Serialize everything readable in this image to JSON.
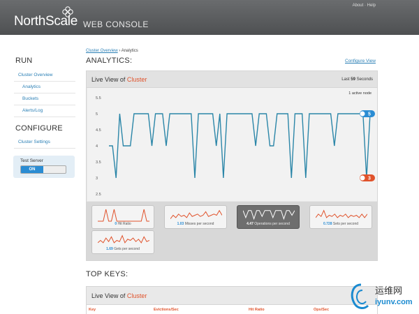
{
  "header": {
    "logo": "NorthScale",
    "product": "WEB CONSOLE",
    "links": [
      "About",
      "Help"
    ],
    "link_sep": "·"
  },
  "sidebar": {
    "run_heading": "RUN",
    "run_items": [
      {
        "label": "Cluster Overview",
        "level": 1
      },
      {
        "label": "Analytics",
        "level": 2
      },
      {
        "label": "Buckets",
        "level": 2
      },
      {
        "label": "Alerts/Log",
        "level": 2
      }
    ],
    "configure_heading": "CONFIGURE",
    "configure_items": [
      {
        "label": "Cluster Settings",
        "level": 1
      }
    ],
    "test_server": {
      "label": "Test Server",
      "state": "ON"
    }
  },
  "main": {
    "breadcrumb_link": "Cluster Overview",
    "breadcrumb_sep": "›",
    "breadcrumb_current": "Analytics",
    "title": "ANALYTICS:",
    "configure_link": "Configure View",
    "live_view": {
      "title_prefix": "Live View of",
      "title_highlight": "Cluster",
      "last_prefix": "Last",
      "last_value": "59",
      "last_suffix": "Seconds",
      "active_nodes": "1 active node"
    },
    "top_keys": {
      "title": "TOP KEYS:",
      "panel_prefix": "Live View of",
      "panel_highlight": "Cluster",
      "columns": [
        "Key",
        "Evictions/Sec",
        "Hit Ratio",
        "Ops/Sec"
      ]
    }
  },
  "chart_data": {
    "type": "line",
    "yticks": [
      "5.5",
      "5",
      "4.5",
      "4",
      "3.5",
      "3",
      "2.5"
    ],
    "ylim": [
      2.5,
      5.5
    ],
    "series": [
      {
        "color": "#2b86a8",
        "values": [
          4,
          4,
          3,
          5,
          4,
          4,
          4,
          5,
          5,
          5,
          5,
          5,
          4,
          5,
          5,
          5,
          4,
          5,
          5,
          5,
          5,
          5,
          5,
          5,
          3,
          5,
          5,
          5,
          5,
          5,
          4,
          5,
          3,
          5,
          5,
          5,
          5,
          5,
          5,
          5,
          5,
          4,
          5,
          5,
          5,
          4,
          4,
          5,
          5,
          5,
          5,
          3,
          5,
          5,
          5,
          3,
          5,
          5,
          5,
          5,
          5,
          5,
          5,
          4,
          5,
          5,
          5,
          5,
          5,
          5,
          5,
          5,
          3,
          5
        ]
      }
    ],
    "markers": [
      {
        "label": "5",
        "color": "#2a8cd3"
      },
      {
        "label": "3",
        "color": "#e0522b"
      }
    ],
    "grid": false,
    "legend": "none"
  },
  "thumbnails": [
    {
      "value": "0",
      "label": "Hit Ratio",
      "color": "#e0522b",
      "selected": false
    },
    {
      "value": "1.03",
      "label": "Misses per second",
      "color": "#e0522b",
      "selected": false
    },
    {
      "value": "4.47",
      "label": "Operations per second",
      "color": "#ffffff",
      "selected": true
    },
    {
      "value": "0.728",
      "label": "Sets per second",
      "color": "#e0522b",
      "selected": false
    },
    {
      "value": "1.69",
      "label": "Gets per second",
      "color": "#e0522b",
      "selected": false
    }
  ],
  "watermark": {
    "cn": "运维网",
    "url": "iyunv.com"
  },
  "colors": {
    "accent_orange": "#e0522b",
    "accent_blue": "#2a8cd3",
    "link": "#2a7fb5"
  }
}
